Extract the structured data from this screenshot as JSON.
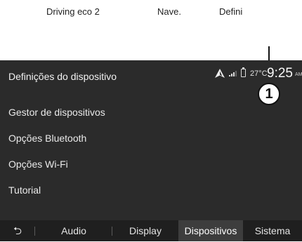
{
  "top_labels": {
    "left": "Driving eco 2",
    "center": "Nave.",
    "right": "Defini"
  },
  "header": {
    "title": "Definições do dispositivo",
    "temperature": "27°C",
    "time": "9:25",
    "time_suffix": "AM"
  },
  "callout": {
    "number": "1"
  },
  "menu": {
    "items": [
      {
        "label": "Gestor de dispositivos"
      },
      {
        "label": "Opções Bluetooth"
      },
      {
        "label": "Opções Wi-Fi"
      },
      {
        "label": "Tutorial"
      }
    ]
  },
  "tabs": {
    "back_icon": "back-arrow-icon",
    "items": [
      {
        "label": "Audio"
      },
      {
        "label": "Display"
      },
      {
        "label": "Dispositivos",
        "active": true
      },
      {
        "label": "Sistema"
      }
    ]
  },
  "colors": {
    "screen_bg": "#2b2b2b",
    "tab_bar_bg": "#1f1f1f",
    "active_tab_bg": "#3d3d3d",
    "text": "#eaeaea"
  },
  "icons": [
    "navigation-arrow-icon",
    "signal-icon",
    "battery-icon",
    "back-arrow-icon"
  ]
}
